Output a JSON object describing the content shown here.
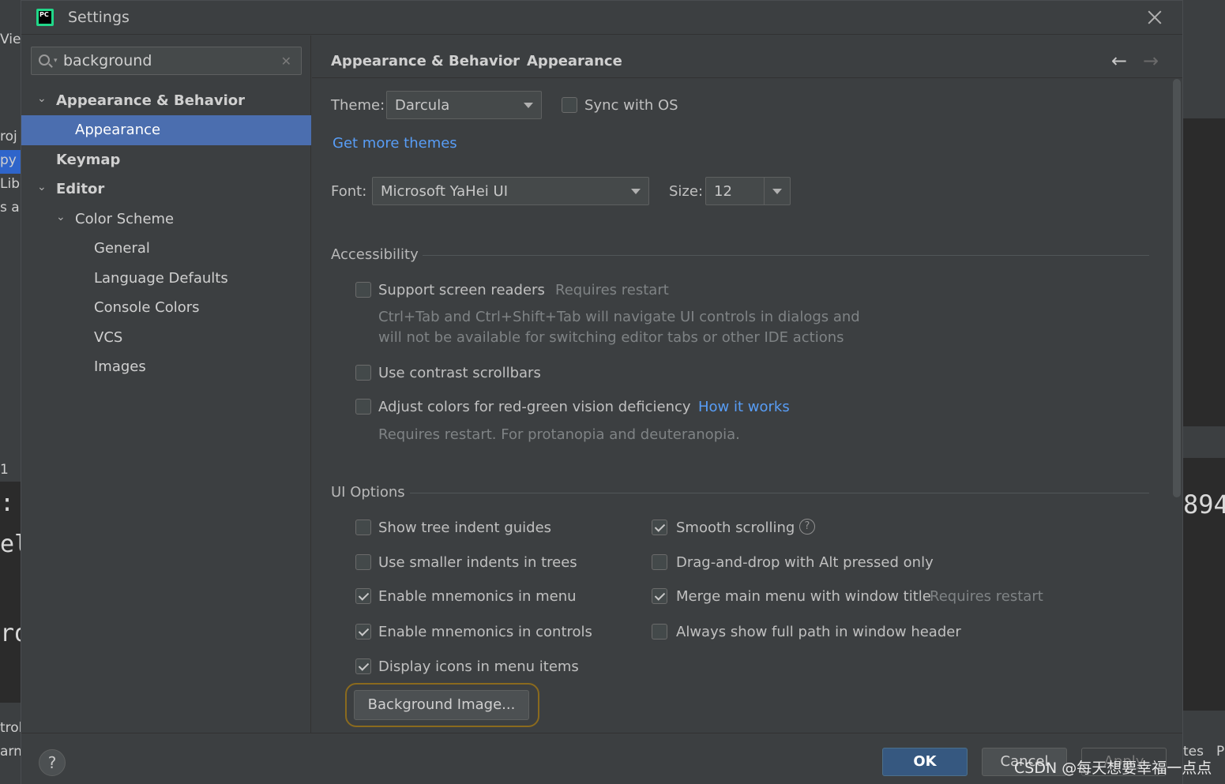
{
  "background_ide": {
    "left_fragments": [
      "Vie",
      "roj",
      "py",
      "Libr",
      "s ar",
      "1",
      ": \\",
      "el",
      "ro",
      "trol",
      "arn"
    ],
    "right_fragments": [
      "894",
      "tes",
      "P"
    ]
  },
  "dialog": {
    "title": "Settings",
    "app_icon_text": "PC"
  },
  "search": {
    "value": "background"
  },
  "sidebar": {
    "items": [
      {
        "label": "Appearance & Behavior"
      },
      {
        "label": "Appearance"
      },
      {
        "label": "Keymap"
      },
      {
        "label": "Editor"
      },
      {
        "label": "Color Scheme"
      },
      {
        "label": "General"
      },
      {
        "label": "Language Defaults"
      },
      {
        "label": "Console Colors"
      },
      {
        "label": "VCS"
      },
      {
        "label": "Images"
      }
    ]
  },
  "breadcrumb": {
    "parent": "Appearance & Behavior",
    "separator": "›",
    "current": "Appearance",
    "back_arrow": "←",
    "forward_arrow": "→"
  },
  "theme": {
    "label": "Theme:",
    "value": "Darcula",
    "sync_label": "Sync with OS",
    "get_more": "Get more themes"
  },
  "font": {
    "label": "Font:",
    "value": "Microsoft YaHei UI",
    "size_label": "Size:",
    "size_value": "12"
  },
  "accessibility": {
    "header": "Accessibility",
    "screen_readers": "Support screen readers",
    "screen_readers_note": "Requires restart",
    "screen_readers_desc1": "Ctrl+Tab and Ctrl+Shift+Tab will navigate UI controls in dialogs and",
    "screen_readers_desc2": "will not be available for switching editor tabs or other IDE actions",
    "contrast_scrollbars": "Use contrast scrollbars",
    "red_green": "Adjust colors for red-green vision deficiency",
    "how_it_works": "How it works",
    "red_green_note": "Requires restart. For protanopia and deuteranopia."
  },
  "ui_options": {
    "header": "UI Options",
    "tree_indent": "Show tree indent guides",
    "smaller_indents": "Use smaller indents in trees",
    "mnemonics_menu": "Enable mnemonics in menu",
    "mnemonics_controls": "Enable mnemonics in controls",
    "display_icons": "Display icons in menu items",
    "smooth_scrolling": "Smooth scrolling",
    "drag_drop": "Drag-and-drop with Alt pressed only",
    "merge_menu": "Merge main menu with window title",
    "merge_menu_note": "Requires restart",
    "full_path": "Always show full path in window header",
    "background_image": "Background Image..."
  },
  "footer": {
    "help": "?",
    "ok": "OK",
    "cancel": "Cancel",
    "apply": "Apply"
  },
  "watermark": "CSDN @每天想要幸福一点点",
  "colors": {
    "selection": "#4b6eaf",
    "link": "#589df6",
    "ok_button": "#365880",
    "highlight_ring": "#8a6a1e"
  }
}
